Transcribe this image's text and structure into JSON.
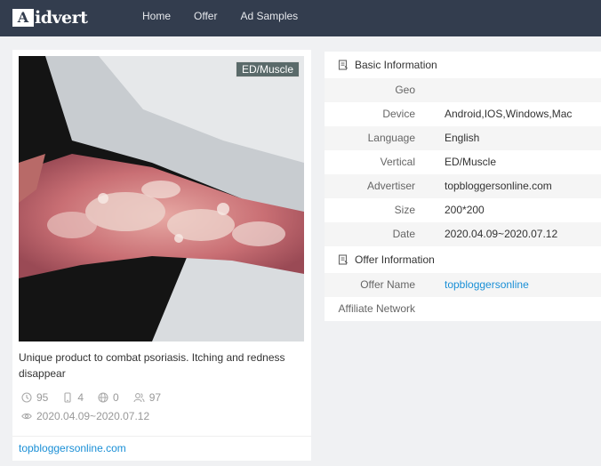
{
  "brand": {
    "logo_mark": "A",
    "logo_text": "idvert"
  },
  "nav": [
    {
      "label": "Home"
    },
    {
      "label": "Offer"
    },
    {
      "label": "Ad Samples"
    }
  ],
  "ad": {
    "tag": "ED/Muscle",
    "title": "Unique product to combat psoriasis. Itching and redness disappear",
    "stats": {
      "views": "95",
      "devices": "4",
      "geos": "0",
      "users": "97"
    },
    "date_range": "2020.04.09~2020.07.12",
    "link_text": "topbloggersonline.com"
  },
  "basic_info": {
    "heading": "Basic Information",
    "rows": [
      {
        "label": "Geo",
        "value": ""
      },
      {
        "label": "Device",
        "value": "Android,IOS,Windows,Mac"
      },
      {
        "label": "Language",
        "value": "English"
      },
      {
        "label": "Vertical",
        "value": "ED/Muscle"
      },
      {
        "label": "Advertiser",
        "value": "topbloggersonline.com"
      },
      {
        "label": "Size",
        "value": "200*200"
      },
      {
        "label": "Date",
        "value": "2020.04.09~2020.07.12"
      }
    ]
  },
  "offer_info": {
    "heading": "Offer Information",
    "rows": [
      {
        "label": "Offer Name",
        "value": "topbloggersonline"
      },
      {
        "label": "Affiliate Network",
        "value": ""
      }
    ]
  },
  "colors": {
    "topbar": "#333d4e",
    "link": "#1a8fd6",
    "page_bg": "#f0f1f3"
  },
  "icons": [
    "clock-icon",
    "mobile-icon",
    "globe-icon",
    "users-icon",
    "eye-icon",
    "document-icon"
  ]
}
